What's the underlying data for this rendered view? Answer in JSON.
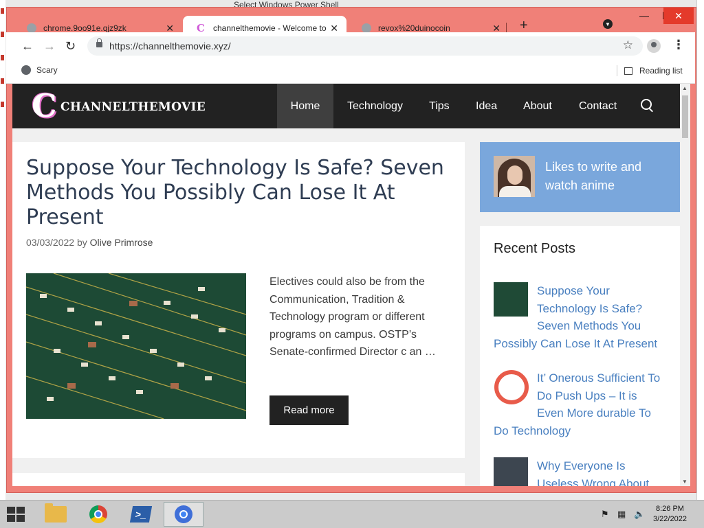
{
  "desktop": {
    "top_text": "Select Windows Power Shell"
  },
  "tabs": [
    {
      "title": "chrome.9oo91e.qjz9zk"
    },
    {
      "title": "channelthemovie - Welcome to M"
    },
    {
      "title": "revox%20duinocoin"
    }
  ],
  "window_controls": {
    "minimize": "—",
    "maximize": "☐",
    "close": "✕"
  },
  "toolbar": {
    "url": "https://channelthemovie.xyz/",
    "back": "←",
    "forward": "→",
    "reload": "↻",
    "star": "☆",
    "menu": "⋮"
  },
  "bookmarks": {
    "item1": "Scary",
    "reading_list": "Reading list"
  },
  "site": {
    "logo_letter": "C",
    "logo_text": "CHANNELTHEMOVIE",
    "nav": [
      "Home",
      "Technology",
      "Tips",
      "Idea",
      "About",
      "Contact"
    ]
  },
  "article": {
    "title": "Suppose Your Technology Is Safe? Seven Methods You Possibly Can Lose It At Present",
    "date": "03/03/2022",
    "by": "by",
    "author": "Olive Primrose",
    "excerpt": "Electives could also be from the Communication, Tradition & Technology program or different programs on campus. OSTP’s Senate-confirmed Director  c an …",
    "read_more": "Read more"
  },
  "sidebar": {
    "author_tagline": "Likes to write and watch anime",
    "recent_heading": "Recent Posts",
    "recent_posts": [
      "Suppose Your Technology Is Safe? Seven Methods You Possibly Can Lose It At Present",
      "It’ Onerous Sufficient To Do Push Ups – It is Even More durable To Do Technology",
      "Why Everyone Is Useless Wrong About"
    ]
  },
  "taskbar": {
    "time": "8:26 PM",
    "date": "3/22/2022"
  },
  "colors": {
    "frame": "#f08078",
    "close_button": "#e43a2b",
    "site_header": "#222222",
    "heading": "#2f3d53",
    "link": "#4a80c0",
    "author_box": "#7aa7dc"
  }
}
